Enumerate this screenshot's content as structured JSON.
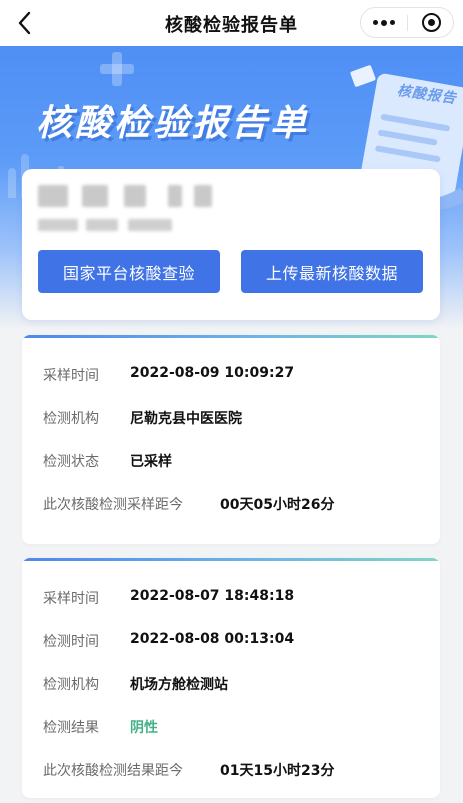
{
  "nav": {
    "title": "核酸检验报告单"
  },
  "hero": {
    "title": "核酸检验报告单",
    "doc_label": "核酸报告"
  },
  "user_card": {
    "buttons": {
      "platform_query": "国家平台核酸查验",
      "upload_latest": "上传最新核酸数据"
    }
  },
  "records": [
    {
      "rows": [
        {
          "label": "采样时间",
          "value": "2022-08-09 10:09:27"
        },
        {
          "label": "检测机构",
          "value": "尼勒克县中医医院"
        },
        {
          "label": "检测状态",
          "value": "已采样"
        },
        {
          "label": "此次核酸检测采样距今",
          "value": "00天05小时26分"
        }
      ]
    },
    {
      "rows": [
        {
          "label": "采样时间",
          "value": "2022-08-07 18:48:18"
        },
        {
          "label": "检测时间",
          "value": "2022-08-08 00:13:04"
        },
        {
          "label": "检测机构",
          "value": "机场方舱检测站"
        },
        {
          "label": "检测结果",
          "value": "阴性"
        },
        {
          "label": "此次核酸检测结果距今",
          "value": "01天15小时23分"
        }
      ]
    }
  ],
  "colors": {
    "primary_button": "#3f73e6",
    "negative_result": "#43b287",
    "hero_blue": "#4f8ff5"
  },
  "icons": {
    "back": "chevron-left-icon",
    "more": "more-dots-icon",
    "close": "close-circle-icon"
  }
}
